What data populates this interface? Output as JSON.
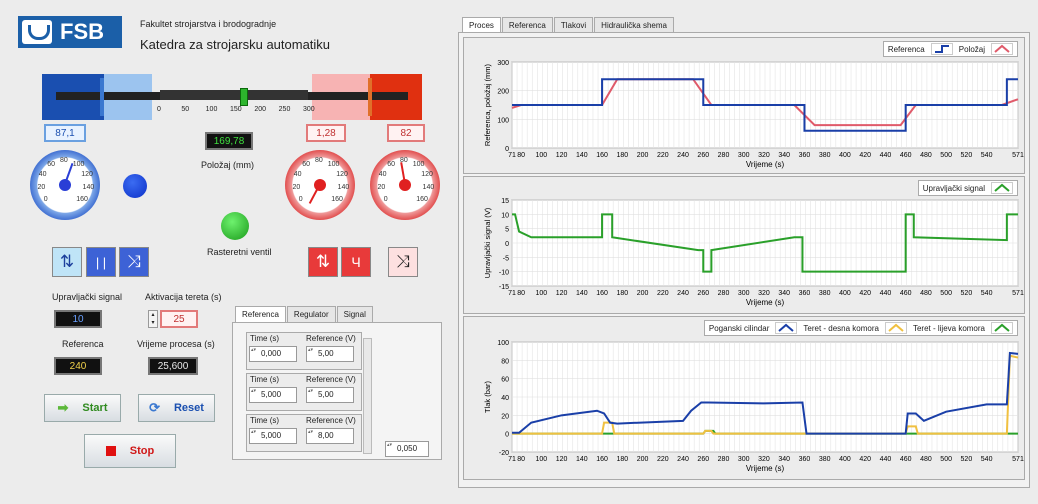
{
  "header": {
    "logo_text": "FSB",
    "faculty": "Fakultet strojarstva i brodogradnje",
    "department": "Katedra za strojarsku automatiku"
  },
  "slider": {
    "ticks": [
      "0",
      "50",
      "100",
      "150",
      "200",
      "250",
      "300"
    ],
    "value_fraction": 0.565
  },
  "left_display": {
    "value": "87,1",
    "color": "#1a4fb0"
  },
  "position_display": {
    "value": "169,78",
    "label": "Položaj (mm)"
  },
  "pressure_a": {
    "value": "1,28"
  },
  "pressure_b": {
    "value": "82"
  },
  "gauge_labels": [
    "0",
    "20",
    "40",
    "60",
    "80",
    "100",
    "120",
    "140",
    "160"
  ],
  "led_label": "Rasteretni ventil",
  "controls": {
    "control_signal_label": "Upravljački signal",
    "control_signal_value": "10",
    "load_activation_label": "Aktivacija tereta (s)",
    "load_activation_value": "25",
    "reference_label": "Referenca",
    "reference_value": "240",
    "process_time_label": "Vrijeme procesa (s)",
    "process_time_value": "25,600",
    "start_label": "Start",
    "reset_label": "Reset",
    "stop_label": "Stop"
  },
  "ref_panel": {
    "tabs": [
      "Referenca",
      "Regulator",
      "Signal"
    ],
    "col_time": "Time (s)",
    "col_ref": "Reference (V)",
    "rows": [
      {
        "time": "0,000",
        "ref": "5,00"
      },
      {
        "time": "5,000",
        "ref": "5,00"
      },
      {
        "time": "5,000",
        "ref": "8,00"
      }
    ],
    "extra_value": "0,050"
  },
  "right_tabs": [
    "Proces",
    "Referenca",
    "Tlakovi",
    "Hidraulička shema"
  ],
  "colors": {
    "reference": "#1a3fa8",
    "position": "#e05a6a",
    "signal": "#2aa02a",
    "load_right": "#f0c040",
    "load_left": "#2aa02a"
  },
  "chart_data": [
    {
      "type": "line",
      "ylabel": "Referenca, položaj (mm)",
      "xlabel": "Vrijeme (s)",
      "xlim": [
        71,
        571
      ],
      "ylim": [
        0,
        300
      ],
      "yticks": [
        0,
        100,
        200,
        300
      ],
      "xticks": [
        71,
        80,
        100,
        120,
        140,
        160,
        180,
        200,
        220,
        240,
        260,
        280,
        300,
        320,
        340,
        360,
        380,
        400,
        420,
        440,
        460,
        480,
        500,
        520,
        540,
        571
      ],
      "series": [
        {
          "name": "Referenca",
          "x": [
            71,
            160,
            160,
            260,
            260,
            360,
            360,
            460,
            460,
            560,
            560,
            571
          ],
          "y": [
            150,
            150,
            240,
            240,
            150,
            150,
            60,
            60,
            150,
            150,
            240,
            240
          ]
        },
        {
          "name": "Položaj",
          "x": [
            71,
            80,
            160,
            175,
            250,
            268,
            350,
            370,
            455,
            470,
            555,
            571
          ],
          "y": [
            140,
            150,
            150,
            240,
            240,
            150,
            150,
            80,
            80,
            150,
            150,
            170
          ]
        }
      ]
    },
    {
      "type": "line",
      "ylabel": "Upravljački signal (V)",
      "xlabel": "Vrijeme (s)",
      "xlim": [
        71,
        571
      ],
      "ylim": [
        -15,
        15
      ],
      "yticks": [
        -15,
        -10,
        -5,
        0,
        5,
        10,
        15
      ],
      "xticks": [
        71,
        80,
        100,
        120,
        140,
        160,
        180,
        200,
        220,
        240,
        260,
        280,
        300,
        320,
        340,
        360,
        380,
        400,
        420,
        440,
        460,
        480,
        500,
        520,
        540,
        571
      ],
      "series": [
        {
          "name": "Upravljački signal",
          "x": [
            71,
            74,
            78,
            90,
            160,
            160,
            170,
            170,
            255,
            260,
            260,
            268,
            268,
            350,
            358,
            358,
            460,
            460,
            468,
            468,
            560,
            560,
            571
          ],
          "y": [
            10,
            10,
            4,
            2,
            2,
            10,
            10,
            2,
            -2.5,
            -2.5,
            -10,
            -10,
            -2.5,
            2,
            2,
            -10,
            -10,
            10,
            10,
            2,
            1,
            10,
            10
          ]
        }
      ]
    },
    {
      "type": "line",
      "ylabel": "Tlak (bar)",
      "xlabel": "Vrijeme (s)",
      "xlim": [
        71,
        571
      ],
      "ylim": [
        -20,
        100
      ],
      "yticks": [
        -20,
        0,
        20,
        40,
        60,
        80,
        100
      ],
      "xticks": [
        71,
        80,
        100,
        120,
        140,
        160,
        180,
        200,
        220,
        240,
        260,
        280,
        300,
        320,
        340,
        360,
        380,
        400,
        420,
        440,
        460,
        480,
        500,
        520,
        540,
        571
      ],
      "series": [
        {
          "name": "Poganski cilindar",
          "x": [
            71,
            78,
            90,
            120,
            155,
            162,
            168,
            175,
            240,
            248,
            258,
            265,
            320,
            358,
            362,
            460,
            462,
            470,
            478,
            500,
            540,
            560,
            563,
            571
          ],
          "y": [
            1,
            1,
            12,
            20,
            25,
            22,
            12,
            11,
            14,
            25,
            34,
            34,
            33,
            34,
            0,
            0,
            22,
            22,
            14,
            24,
            32,
            32,
            88,
            87
          ]
        },
        {
          "name": "Teret - desna komora",
          "x": [
            71,
            160,
            162,
            170,
            172,
            260,
            262,
            268,
            270,
            460,
            462,
            470,
            472,
            560,
            563,
            571
          ],
          "y": [
            0,
            0,
            12,
            12,
            0,
            0,
            3,
            3,
            0,
            0,
            8,
            8,
            0,
            0,
            85,
            83
          ]
        },
        {
          "name": "Teret - lijeva komora",
          "x": [
            71,
            260,
            262,
            270,
            272,
            571
          ],
          "y": [
            0,
            0,
            3,
            3,
            0,
            0
          ]
        }
      ]
    }
  ]
}
